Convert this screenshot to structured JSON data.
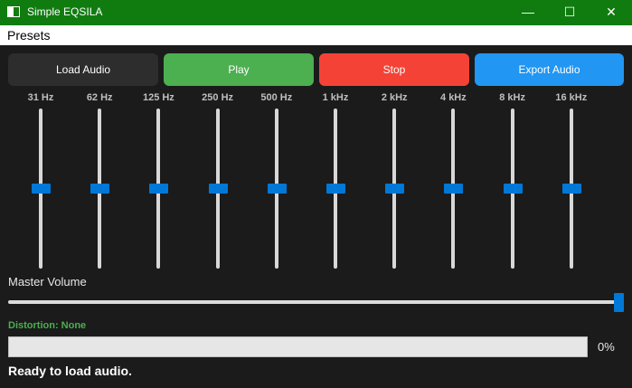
{
  "window": {
    "title": "Simple EQSILA",
    "minimize_glyph": "—",
    "maximize_glyph": "☐",
    "close_glyph": "✕"
  },
  "menu": {
    "presets_label": "Presets"
  },
  "buttons": {
    "load_label": "Load Audio",
    "play_label": "Play",
    "stop_label": "Stop",
    "export_label": "Export Audio"
  },
  "colors": {
    "load": "#2d2d2d",
    "play": "#4caf50",
    "stop": "#f44336",
    "export": "#2196f3",
    "accent": "#0078d7"
  },
  "bands": [
    {
      "label": "31 Hz",
      "level": 0.5
    },
    {
      "label": "62 Hz",
      "level": 0.5
    },
    {
      "label": "125 Hz",
      "level": 0.5
    },
    {
      "label": "250 Hz",
      "level": 0.5
    },
    {
      "label": "500 Hz",
      "level": 0.5
    },
    {
      "label": "1 kHz",
      "level": 0.5
    },
    {
      "label": "2 kHz",
      "level": 0.5
    },
    {
      "label": "4 kHz",
      "level": 0.5
    },
    {
      "label": "8 kHz",
      "level": 0.5
    },
    {
      "label": "16 kHz",
      "level": 0.5
    }
  ],
  "master": {
    "label": "Master Volume",
    "level": 1.0
  },
  "distortion": {
    "text": "Distortion: None"
  },
  "progress": {
    "value": 0,
    "text": "0%"
  },
  "status": {
    "text": "Ready to load audio."
  }
}
